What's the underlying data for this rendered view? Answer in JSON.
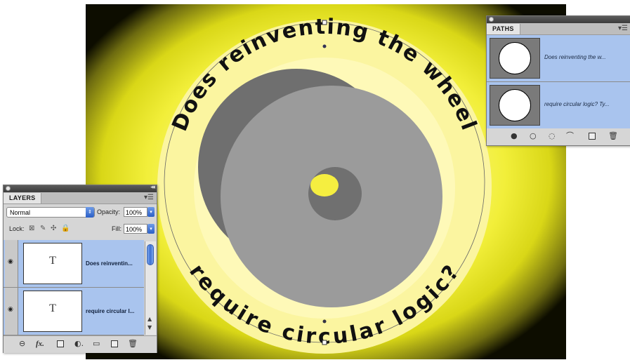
{
  "canvas": {
    "text_top": "Does reinventing the wheel",
    "text_bottom": "require circular logic?",
    "colors": {
      "background_center": "#fffbd0",
      "background_edge": "#0d0d00",
      "wheel": "#9a9a9a",
      "wheel_shadow": "#707070"
    }
  },
  "paths_panel": {
    "tab_label": "PATHS",
    "menu_icon": "panel-menu-icon",
    "items": [
      {
        "name": "Does reinventing the w..."
      },
      {
        "name": "require circular logic? Ty..."
      }
    ],
    "footer_icons": [
      "fill-path-icon",
      "stroke-path-icon",
      "load-selection-icon",
      "make-work-path-icon",
      "new-path-icon",
      "trash-icon"
    ]
  },
  "layers_panel": {
    "tab_label": "LAYERS",
    "blend_mode": "Normal",
    "opacity_label": "Opacity:",
    "opacity_value": "100%",
    "lock_label": "Lock:",
    "fill_label": "Fill:",
    "fill_value": "100%",
    "layers": [
      {
        "thumb_glyph": "T",
        "name": "Does reinventin..."
      },
      {
        "thumb_glyph": "T",
        "name": "require circular l..."
      }
    ],
    "footer_icons": [
      "link-icon",
      "fx-icon",
      "mask-icon",
      "adjustment-icon",
      "group-icon",
      "new-layer-icon",
      "trash-icon"
    ]
  }
}
